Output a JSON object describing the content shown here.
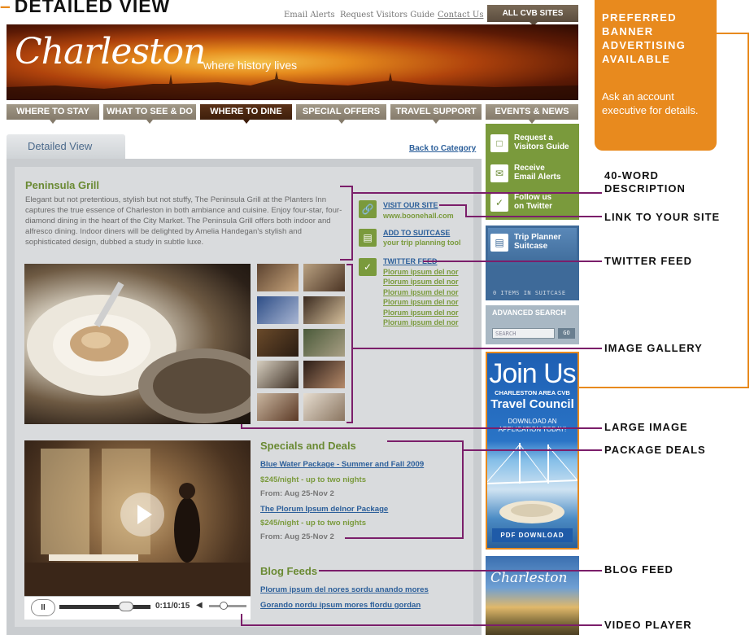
{
  "page_title": "DETAILED VIEW",
  "top_links": [
    "Email Alerts",
    "Request Visitors Guide",
    "Contact Us"
  ],
  "all_cvb_sites": "ALL CVB SITES",
  "banner": {
    "brand": "Charleston",
    "tagline": "where history lives"
  },
  "nav": [
    "WHERE TO STAY",
    "WHAT TO SEE & DO",
    "WHERE TO DINE",
    "SPECIAL OFFERS",
    "TRAVEL SUPPORT",
    "EVENTS & NEWS"
  ],
  "content": {
    "tab": "Detailed View",
    "back": "Back to Category",
    "title": "Peninsula Grill",
    "description": "Elegant but not pretentious, stylish but not stuffy, The Peninsula Grill at the Planters Inn captures the true essence of Charleston in both ambiance and cuisine. Enjoy four-star, four-diamond dining in the heart of the City Market. The Peninsula Grill offers both indoor and alfresco dining. Indoor diners will be delighted by Amelia Handegan's stylish and sophisticated design, dubbed a study in subtle luxe.",
    "visit_site": "VISIT OUR SITE",
    "site_url": "www.boonehall.com",
    "add_suitcase": "ADD TO SUITCASE",
    "suitcase_sub": "your trip planning tool",
    "twitter_feed": "TWITTER FEED",
    "tweets": [
      "Plorum ipsum del nor",
      "Plorum ipsum del nor",
      "Plorum ipsum del nor",
      "Plorum ipsum del nor",
      "Plorum ipsum del nor",
      "Plorum ipsum del nor"
    ],
    "specials_title": "Specials and Deals",
    "deals": [
      {
        "name": "Blue Water Package - Summer and Fall 2009",
        "price": "$245/night - up to two nights",
        "dates": "From: Aug 25-Nov 2"
      },
      {
        "name": "The Plorum Ipsum delnor Package",
        "price": "$245/night - up to two nights",
        "dates": "From: Aug 25-Nov 2"
      }
    ],
    "blog_title": "Blog Feeds",
    "blog_posts": [
      "Plorum ipsum del nores sordu anando mores",
      "Gorando nordu ipsum mores flordu gordan"
    ],
    "video_time": "0:11/0:15",
    "video_progress": 0.73
  },
  "sidebar": {
    "request_guide": "Request a\nVisitors Guide",
    "email_alerts": "Receive\nEmail Alerts",
    "follow_twitter": "Follow us\non Twitter",
    "trip_planner": "Trip Planner\nSuitcase",
    "items_in_suitcase": "0 ITEMS IN SUITCASE",
    "advanced_search": "ADVANCED SEARCH",
    "search_placeholder": "SEARCH",
    "go": "GO"
  },
  "ads": {
    "join_title": "Join Us",
    "join_sub": "CHARLESTON AREA CVB",
    "join_big": "Travel Council",
    "join_dl": "DOWNLOAD AN APPLICATION TODAY!",
    "pdf": "PDF DOWNLOAD",
    "charleston": "Charleston"
  },
  "promo": {
    "title": "PREFERRED BANNER ADVERTISING AVAILABLE",
    "body": "Ask an account executive for details."
  },
  "callouts": [
    "40-WORD DESCRIPTION",
    "LINK TO YOUR SITE",
    "TWITTER FEED",
    "IMAGE GALLERY",
    "LARGE IMAGE",
    "PACKAGE DEALS",
    "BLOG FEED",
    "VIDEO PLAYER"
  ],
  "colors": {
    "accent_orange": "#e88a1e",
    "callout_purple": "#7b1e6a",
    "brand_green": "#7a9a3c",
    "link_blue": "#2c5f9a"
  }
}
